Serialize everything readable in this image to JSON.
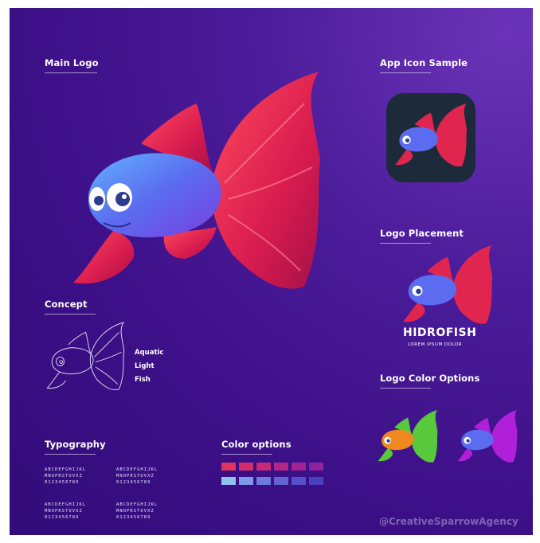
{
  "sections": {
    "main_logo": "Main Logo",
    "app_icon": "App Icon Sample",
    "logo_placement": "Logo Placement",
    "logo_color_options": "Logo Color Options",
    "concept": "Concept",
    "typography": "Typography",
    "color_options": "Color options"
  },
  "concept_words": [
    "Aquatic",
    "Light",
    "Fish"
  ],
  "brand": {
    "name": "HIDROFISH",
    "tagline": "LOREM IPSUM DOLOR"
  },
  "typography_samples": [
    {
      "line1": "ABCDEFGHIJKL",
      "line2": "MNOPRSTUVXZ",
      "line3": "0123456789"
    },
    {
      "line1": "ABCDEFGHIJKL",
      "line2": "MNOPRSTUVXZ",
      "line3": "0123456789"
    },
    {
      "line1": "ABCDEFGHIJKL",
      "line2": "MNOPRSTUVXZ",
      "line3": "0123456789"
    },
    {
      "line1": "ABCDEFGHIJKL",
      "line2": "MNOPRSTUVXZ",
      "line3": "0123456789"
    }
  ],
  "palette": {
    "warm": [
      "#e0335e",
      "#d22d6a",
      "#c42a78",
      "#b42686",
      "#a22493",
      "#8f229d"
    ],
    "cool": [
      "#8fc3f0",
      "#7f9ae8",
      "#6f7adf",
      "#6264d4",
      "#5650c8",
      "#4a3fbd"
    ]
  },
  "colors": {
    "fish_body": "#5b6cf0",
    "fin_red": "#e0264f",
    "variant_green": "#58c93a",
    "variant_purple": "#b020d8"
  },
  "watermark": "@CreativeSparrowAgency"
}
